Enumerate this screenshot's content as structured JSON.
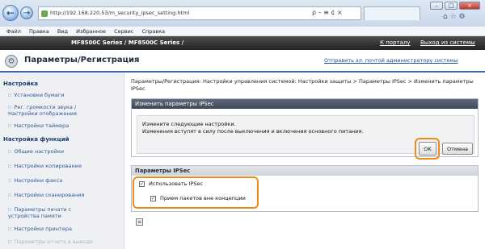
{
  "browser": {
    "back_glyph": "←",
    "forward_glyph": "→",
    "address": "http://192.168.220.53/m_security_ipsec_setting.html",
    "address_tools": "ρ – ≡ ¢ ×",
    "tab_label": "",
    "window_controls": [
      "–",
      "□",
      "×"
    ],
    "corner_icons": "⌂ ☆ ⚙"
  },
  "menubar": {
    "items": [
      "Файл",
      "Правка",
      "Вид",
      "Избранное",
      "Сервис",
      "Справка"
    ]
  },
  "appbar": {
    "device": "MF8500C Series / MF8500C Series /",
    "portal_link": "К порталу",
    "logout_link": "Выход из системы"
  },
  "title": {
    "text": "Параметры/Регистрация",
    "mail_link": "Отправить эл. почтой администратору системы"
  },
  "sidebar": {
    "sections": [
      {
        "label": "Настройка",
        "items": [
          "Установки бумаги",
          "Рег. громкости звука / Настройки отображения",
          "Настройки таймера"
        ]
      },
      {
        "label": "Настройка функций",
        "items": [
          "Общие настройки",
          "Настройки копирования",
          "Настройки факса",
          "Настройки сканирования",
          "Параметры печати с устройства памяти",
          "Настройки принтера",
          "Параметры отчета в выводе"
        ]
      }
    ]
  },
  "main": {
    "breadcrumb": "Параметры/Регистрация: Настройки управления системой: Настройки защиты > Параметры IPSec > Изменить параметры IPSec",
    "panel_title": "Изменить параметры IPSec",
    "instruction_line1": "Измените следующие настройки.",
    "instruction_line2": "Изменения вступят в силу после выключения и включения основного питания.",
    "ok_label": "OK",
    "cancel_label": "Отмена",
    "section_title": "Параметры IPSec",
    "use_ipsec_label": "Использовать IPSec",
    "use_ipsec_checked": true,
    "accept_packets_label": "Прием пакетов вне концепции",
    "accept_packets_checked": true,
    "accent_color": "#f08a1c",
    "header_color": "#3d4856"
  }
}
